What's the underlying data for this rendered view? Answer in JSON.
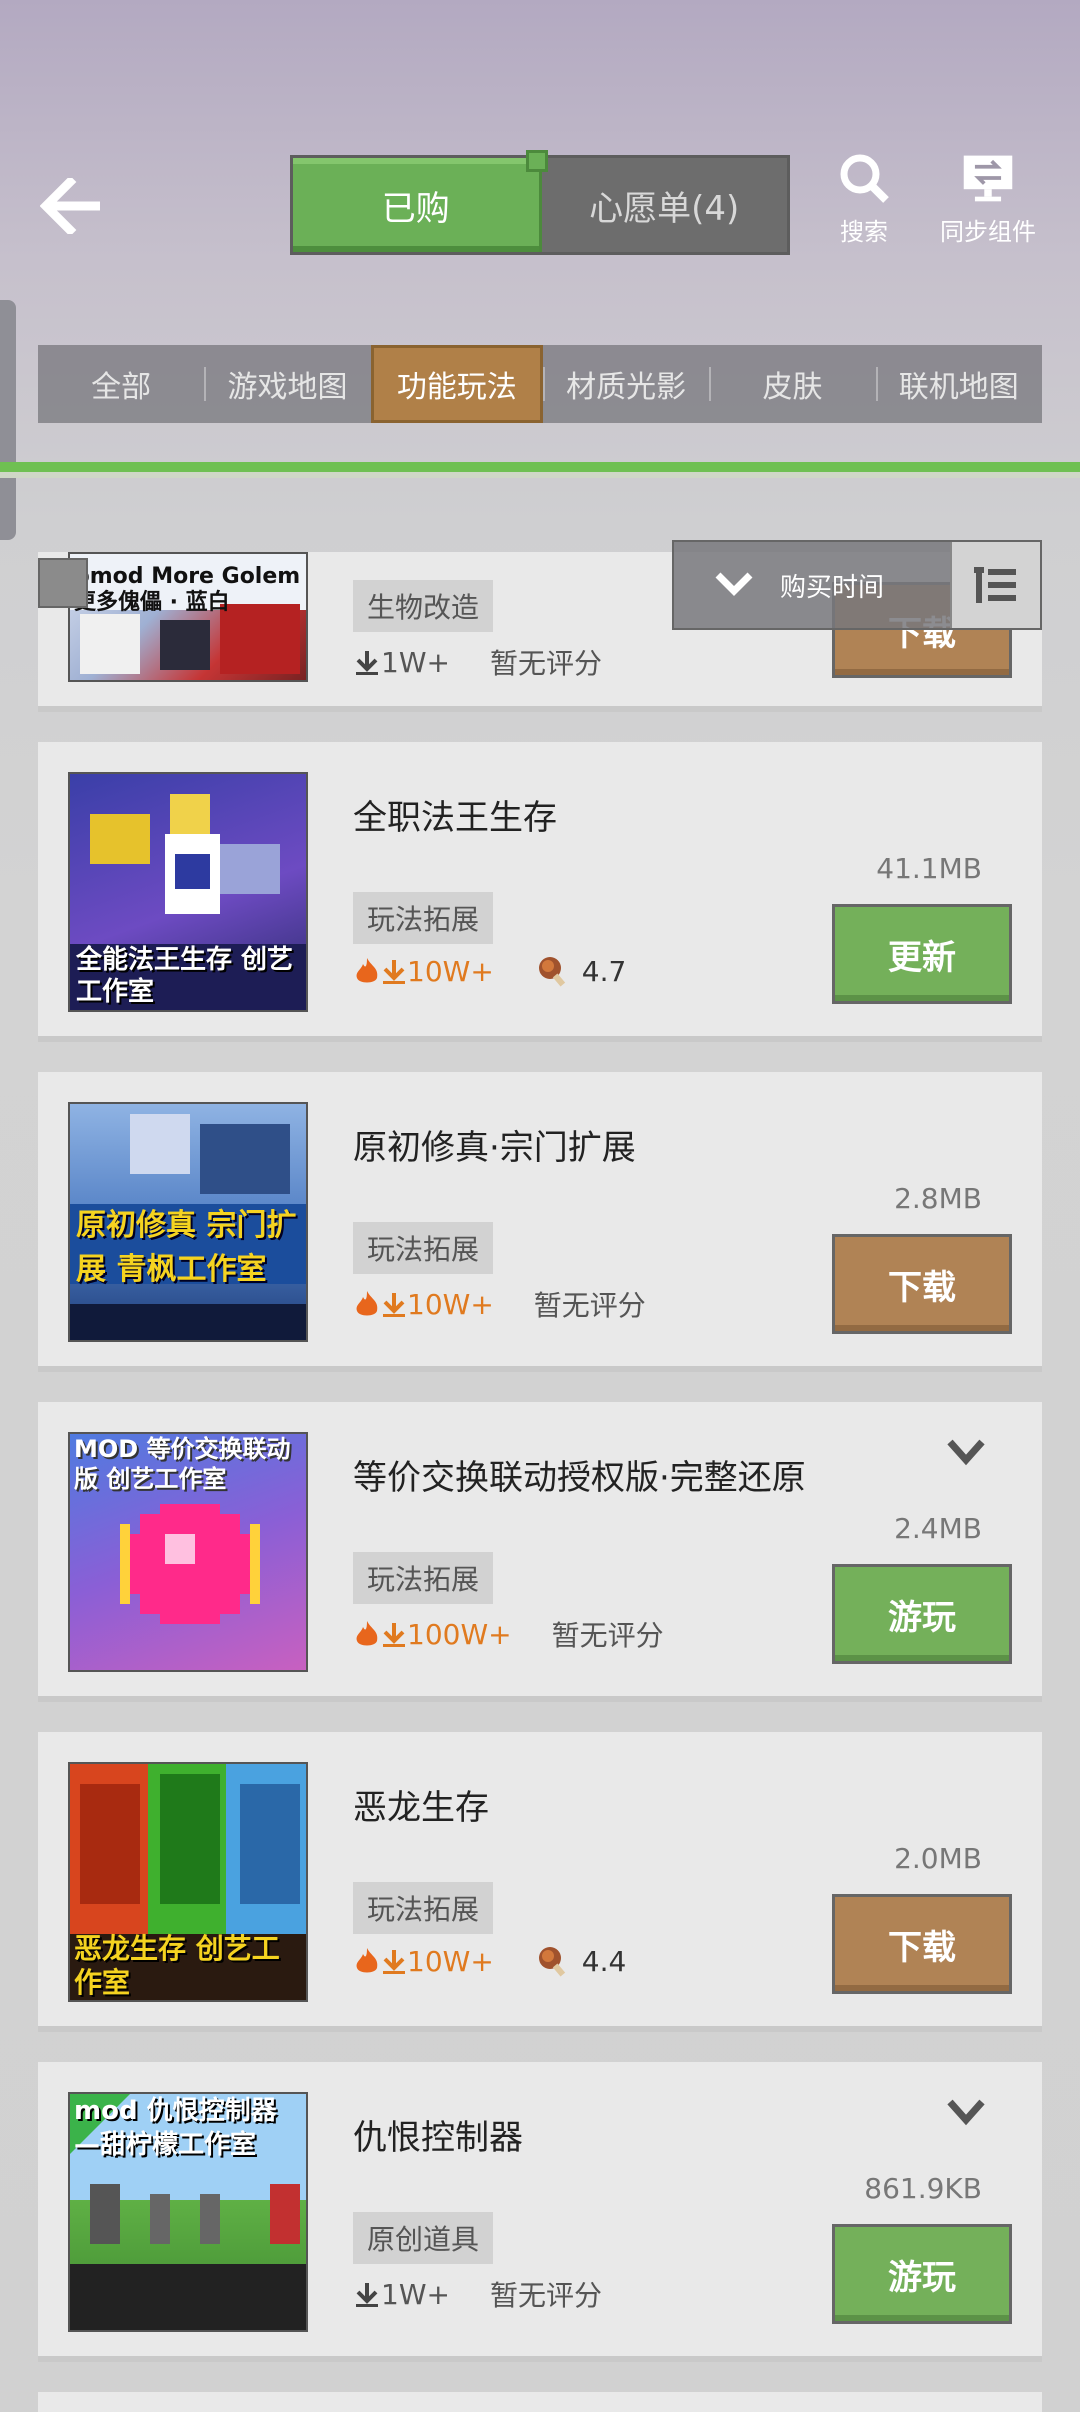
{
  "header": {
    "tab_purchased": "已购",
    "tab_wishlist": "心愿单(4)",
    "search_label": "搜索",
    "sync_label": "同步组件"
  },
  "categories": [
    "全部",
    "游戏地图",
    "功能玩法",
    "材质光影",
    "皮肤",
    "联机地图"
  ],
  "active_category": "功能玩法",
  "sort": {
    "label": "购买时间"
  },
  "items": [
    {
      "title": "",
      "tag": "生物改造",
      "downloads": "1W+",
      "rating": "暂无评分",
      "size": "",
      "action": "下载",
      "thumb_text": "bmod More Golem 更多傀儡 · 蓝白"
    },
    {
      "title": "全职法王生存",
      "tag": "玩法拓展",
      "downloads": "10W+",
      "rating": "4.7",
      "size": "41.1MB",
      "action": "更新",
      "thumb_text": "全能法王生存 创艺工作室"
    },
    {
      "title": "原初修真·宗门扩展",
      "tag": "玩法拓展",
      "downloads": "10W+",
      "rating": "暂无评分",
      "size": "2.8MB",
      "action": "下载",
      "thumb_text": "原初修真 宗门扩展 青枫工作室"
    },
    {
      "title": "等价交换联动授权版·完整还原",
      "tag": "玩法拓展",
      "downloads": "100W+",
      "rating": "暂无评分",
      "size": "2.4MB",
      "action": "游玩",
      "thumb_text": "MOD 等价交换联动版 创艺工作室"
    },
    {
      "title": "恶龙生存",
      "tag": "玩法拓展",
      "downloads": "10W+",
      "rating": "4.4",
      "size": "2.0MB",
      "action": "下载",
      "thumb_text": "恶龙生存 创艺工作室"
    },
    {
      "title": "仇恨控制器",
      "tag": "原创道具",
      "downloads": "1W+",
      "rating": "暂无评分",
      "size": "861.9KB",
      "action": "游玩",
      "thumb_text": "mod 仇恨控制器 —甜柠檬工作室"
    }
  ],
  "colors": {
    "green": "#74b05a",
    "brown": "#b08355",
    "accent_orange": "#e07a1f"
  }
}
